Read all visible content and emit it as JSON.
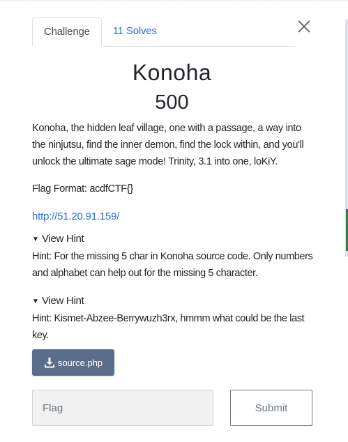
{
  "tabs": [
    {
      "label": "Challenge",
      "active": true
    },
    {
      "label": "11 Solves",
      "active": false
    }
  ],
  "close_icon": "close-icon",
  "challenge": {
    "name": "Konoha",
    "value": "500",
    "description": "Konoha, the hidden leaf village, one with a passage, a way into the ninjutsu, find the inner demon, find the lock within, and you'll unlock the ultimate sage mode! Trinity, 3.1 into one, loKiY.",
    "flag_format": "Flag Format: acdfCTF{}",
    "url": "http://51.20.91.159/"
  },
  "hints": [
    {
      "summary": "View Hint",
      "text": "Hint: For the missing 5 char in Konoha source code. Only numbers and alphabet can help out for the missing 5 character."
    },
    {
      "summary": "View Hint",
      "text": "Hint: Kismet-Abzee-Berrywuzh3rx, hmmm what could be the last key."
    }
  ],
  "download": {
    "label": "source.php",
    "icon": "download-icon"
  },
  "flag_input": {
    "placeholder": "Flag",
    "value": ""
  },
  "submit": {
    "label": "Submit"
  },
  "colors": {
    "link": "#2a6fd6",
    "download_button": "#5a6e8c",
    "input_background": "#f1f1f1"
  }
}
